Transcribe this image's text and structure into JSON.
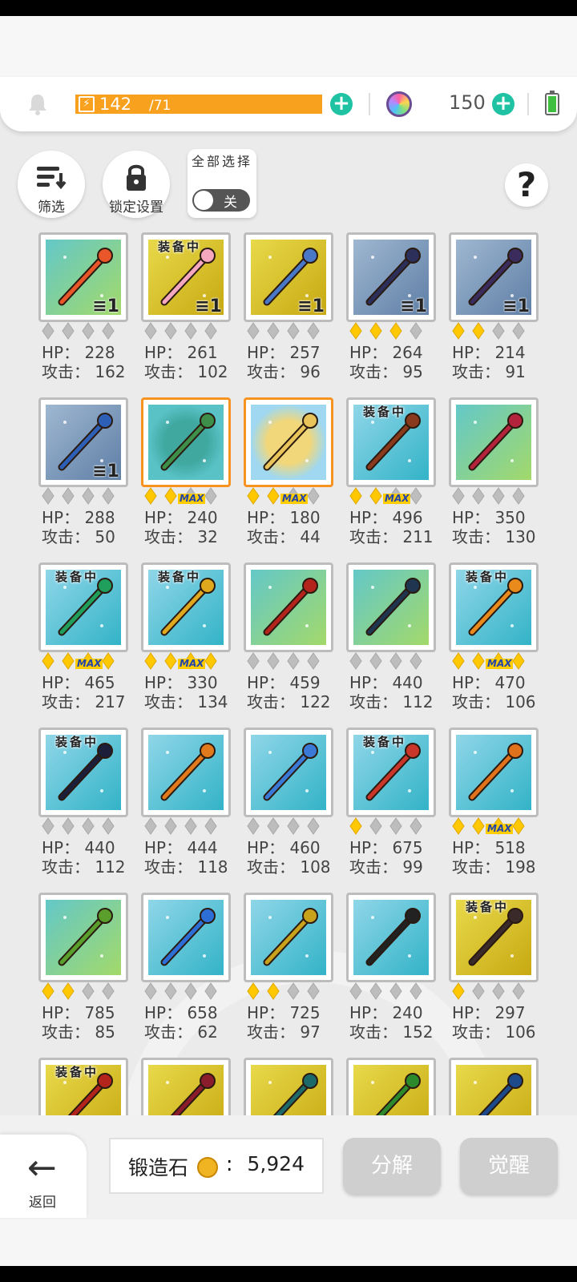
{
  "topbar": {
    "energy_current": "142",
    "energy_max": "/71",
    "energy_icon": "lightning-icon",
    "gem_count": "150"
  },
  "toolbar": {
    "filter_label": "筛选",
    "lock_label": "锁定设置",
    "select_all_label": "全部选择",
    "select_all_state": "关",
    "help_label": "?"
  },
  "labels": {
    "hp": "HP：",
    "atk": "攻击：",
    "equipped": "装备中",
    "max": "MAX"
  },
  "items": [
    {
      "hp": "228",
      "atk": "162",
      "stars": 0,
      "max": false,
      "equipped": false,
      "count": "1",
      "bg": "bg-teal",
      "icon": "crossbow-icon",
      "color": "#e8562a"
    },
    {
      "hp": "261",
      "atk": "102",
      "stars": 0,
      "max": false,
      "equipped": true,
      "count": "1",
      "bg": "bg-yellow",
      "icon": "lightsaber-icon",
      "color": "#f6a7c0"
    },
    {
      "hp": "257",
      "atk": "96",
      "stars": 0,
      "max": false,
      "equipped": false,
      "count": "1",
      "bg": "bg-yellow",
      "icon": "shuriken-staff-icon",
      "color": "#4a78c8"
    },
    {
      "hp": "264",
      "atk": "95",
      "stars": 3,
      "max": false,
      "equipped": false,
      "count": "1",
      "bg": "bg-blue",
      "icon": "dagger-icon",
      "color": "#2b2f5a"
    },
    {
      "hp": "214",
      "atk": "91",
      "stars": 2,
      "max": false,
      "equipped": false,
      "count": "1",
      "bg": "bg-blue",
      "icon": "scythe-icon",
      "color": "#3a2c5c"
    },
    {
      "hp": "288",
      "atk": "50",
      "stars": 0,
      "max": false,
      "equipped": false,
      "count": "1",
      "bg": "bg-blue",
      "icon": "winged-shield-icon",
      "color": "#2c5fb5"
    },
    {
      "hp": "240",
      "atk": "32",
      "stars": 2,
      "max": true,
      "equipped": false,
      "count": "",
      "bg": "bg-orb",
      "icon": "forest-orb-icon",
      "color": "#3d8f4a"
    },
    {
      "hp": "180",
      "atk": "44",
      "stars": 2,
      "max": true,
      "equipped": false,
      "count": "",
      "bg": "bg-orb2",
      "icon": "desert-orb-icon",
      "color": "#e8c45a"
    },
    {
      "hp": "496",
      "atk": "211",
      "stars": 2,
      "max": true,
      "equipped": true,
      "count": "",
      "bg": "bg-teal2",
      "icon": "crossed-spears-icon",
      "color": "#8a3a1c"
    },
    {
      "hp": "350",
      "atk": "130",
      "stars": 0,
      "max": false,
      "equipped": false,
      "count": "",
      "bg": "bg-teal",
      "icon": "rose-staff-icon",
      "color": "#b3243c"
    },
    {
      "hp": "465",
      "atk": "217",
      "stars": 4,
      "max": true,
      "equipped": true,
      "count": "",
      "bg": "bg-teal2",
      "icon": "jade-spear-icon",
      "color": "#1f9e5c"
    },
    {
      "hp": "330",
      "atk": "134",
      "stars": 4,
      "max": true,
      "equipped": true,
      "count": "",
      "bg": "bg-teal2",
      "icon": "golden-halberd-icon",
      "color": "#e0a81c"
    },
    {
      "hp": "459",
      "atk": "122",
      "stars": 0,
      "max": false,
      "equipped": false,
      "count": "",
      "bg": "bg-teal",
      "icon": "fire-bow-icon",
      "color": "#b3241c"
    },
    {
      "hp": "440",
      "atk": "112",
      "stars": 0,
      "max": false,
      "equipped": false,
      "count": "",
      "bg": "bg-teal",
      "icon": "tablet-icon",
      "color": "#1f3550"
    },
    {
      "hp": "470",
      "atk": "106",
      "stars": 4,
      "max": true,
      "equipped": true,
      "count": "",
      "bg": "bg-teal2",
      "icon": "spellbook-icon",
      "color": "#e88a1c"
    },
    {
      "hp": "440",
      "atk": "112",
      "stars": 0,
      "max": false,
      "equipped": true,
      "count": "",
      "bg": "bg-teal2",
      "icon": "dark-axe-icon",
      "color": "#1c1f3a"
    },
    {
      "hp": "444",
      "atk": "118",
      "stars": 0,
      "max": false,
      "equipped": false,
      "count": "",
      "bg": "bg-teal2",
      "icon": "mace-icon",
      "color": "#e07a1c"
    },
    {
      "hp": "460",
      "atk": "108",
      "stars": 0,
      "max": false,
      "equipped": false,
      "count": "",
      "bg": "bg-teal2",
      "icon": "ice-staff-icon",
      "color": "#3a7ad6"
    },
    {
      "hp": "675",
      "atk": "99",
      "stars": 1,
      "max": false,
      "equipped": true,
      "count": "",
      "bg": "bg-teal2",
      "icon": "bell-wreath-icon",
      "color": "#c9362a"
    },
    {
      "hp": "518",
      "atk": "198",
      "stars": 4,
      "max": true,
      "equipped": false,
      "count": "",
      "bg": "bg-teal2",
      "icon": "ornate-shield-icon",
      "color": "#e0721c"
    },
    {
      "hp": "785",
      "atk": "85",
      "stars": 2,
      "max": false,
      "equipped": false,
      "count": "",
      "bg": "bg-teal",
      "icon": "necklace-icon",
      "color": "#5a9e2c"
    },
    {
      "hp": "658",
      "atk": "62",
      "stars": 0,
      "max": false,
      "equipped": false,
      "count": "",
      "bg": "bg-teal2",
      "icon": "potion-icon",
      "color": "#2c6ed6"
    },
    {
      "hp": "725",
      "atk": "97",
      "stars": 2,
      "max": false,
      "equipped": false,
      "count": "",
      "bg": "bg-teal2",
      "icon": "bracelet-icon",
      "color": "#c9a21c"
    },
    {
      "hp": "240",
      "atk": "152",
      "stars": 0,
      "max": false,
      "equipped": false,
      "count": "",
      "bg": "bg-teal2",
      "icon": "rifle-icon",
      "color": "#222"
    },
    {
      "hp": "297",
      "atk": "106",
      "stars": 1,
      "max": false,
      "equipped": true,
      "count": "",
      "bg": "bg-yellow",
      "icon": "greatsword-icon",
      "color": "#3a2a2a"
    },
    {
      "hp": "",
      "atk": "",
      "stars": 0,
      "max": false,
      "equipped": true,
      "count": "",
      "bg": "bg-yellow",
      "icon": "crimson-sword-icon",
      "color": "#b3241c"
    },
    {
      "hp": "",
      "atk": "",
      "stars": 0,
      "max": false,
      "equipped": false,
      "count": "",
      "bg": "bg-yellow",
      "icon": "winged-blade-icon",
      "color": "#8a1c2c"
    },
    {
      "hp": "",
      "atk": "",
      "stars": 0,
      "max": false,
      "equipped": false,
      "count": "",
      "bg": "bg-yellow",
      "icon": "trident-icon",
      "color": "#1c6a6a"
    },
    {
      "hp": "",
      "atk": "",
      "stars": 0,
      "max": false,
      "equipped": false,
      "count": "",
      "bg": "bg-yellow",
      "icon": "spear-icon",
      "color": "#2c8a2c"
    },
    {
      "hp": "",
      "atk": "",
      "stars": 0,
      "max": false,
      "equipped": false,
      "count": "",
      "bg": "bg-yellow",
      "icon": "blue-bow-icon",
      "color": "#1c4a8a"
    }
  ],
  "footer": {
    "back_label": "返回",
    "forge_stone_label": "锻造石",
    "forge_stone_value": "5,924",
    "disassemble_label": "分解",
    "awaken_label": "觉醒"
  }
}
